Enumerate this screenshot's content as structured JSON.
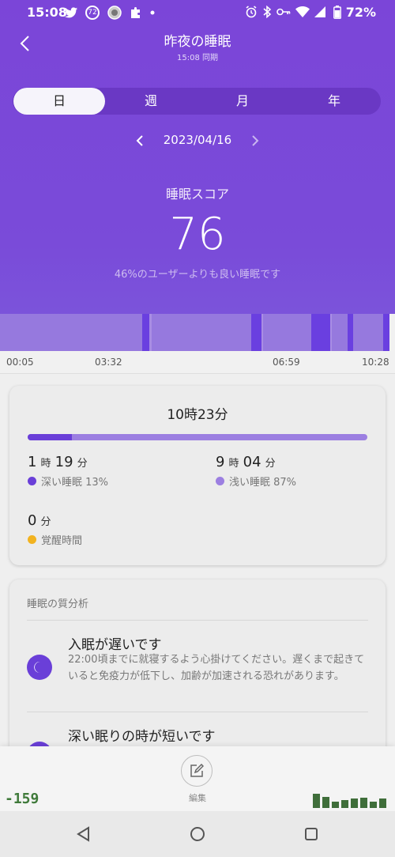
{
  "status": {
    "time": "15:08",
    "badge": "72",
    "battery": "72%"
  },
  "nav": {
    "title": "昨夜の睡眠",
    "subtitle": "15:08 同期"
  },
  "tabs": [
    {
      "label": "日",
      "active": true
    },
    {
      "label": "週",
      "active": false
    },
    {
      "label": "月",
      "active": false
    },
    {
      "label": "年",
      "active": false
    }
  ],
  "date": "2023/04/16",
  "score": {
    "label": "睡眠スコア",
    "value": "76",
    "comparison": "46%のユーザーよりも良い睡眠です"
  },
  "timeline": [
    "00:05",
    "03:32",
    "06:59",
    "10:28"
  ],
  "summary": {
    "total": "10時23分",
    "deep_fraction": 0.13,
    "deep": {
      "h": "1",
      "h_unit": "時",
      "m": "19",
      "m_unit": "分",
      "label": "深い睡眠 13%"
    },
    "light": {
      "h": "9",
      "h_unit": "時",
      "m": "04",
      "m_unit": "分",
      "label": "浅い睡眠 87%"
    },
    "awake": {
      "m": "0",
      "m_unit": "分",
      "label": "覚醒時間"
    }
  },
  "colors": {
    "deep": "#6a3fd8",
    "light": "#9c7fe1",
    "awake": "#f2b320"
  },
  "analysis": {
    "title": "睡眠の質分析",
    "items": [
      {
        "title": "入眠が遅いです",
        "desc": "22:00頃までに就寝するよう心掛けてください。遅くまで起きていると免疫力が低下し、加齢が加速される恐れがあります。",
        "icon": "moon-icon"
      },
      {
        "title": "深い眠りの時が短いです",
        "desc": "",
        "icon": "moon-icon"
      }
    ]
  },
  "bottom": {
    "edit_label": "編集",
    "counter": "-159"
  }
}
